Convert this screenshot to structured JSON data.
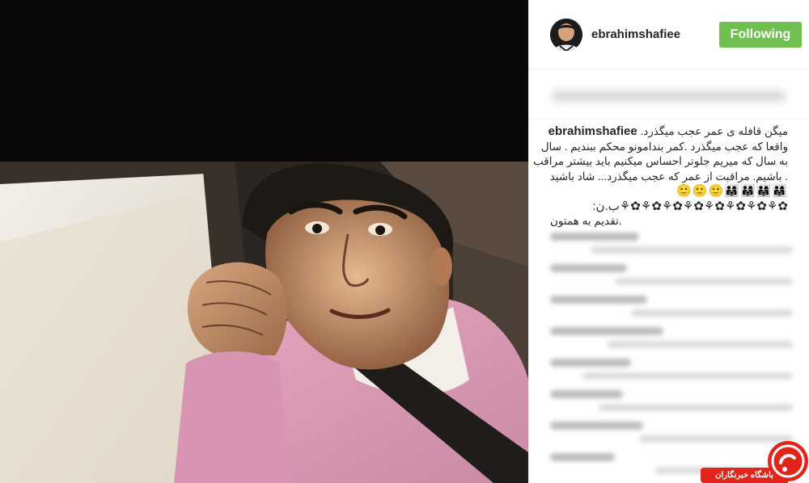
{
  "post": {
    "photo_description_icon": "photo-icon"
  },
  "header": {
    "username": "ebrahimshafiee",
    "follow_button_label": "Following",
    "follow_button_color": "#70c050"
  },
  "caption": {
    "username": "ebrahimshafiee",
    "line1": "میگن قافله ی عمر عجب میگذرد.",
    "line2": "واقعا که عجب میگذرد .کمر بندامونو محکم ببندیم . سال",
    "line3": "به سال که میریم جلوتر احساس میکنیم باید بیشتر مراقب",
    "line4": ". باشیم. مراقبت از عمر که عجب میگذرد... شاد باشید",
    "line5": "👨‍👩‍👧👨‍👩‍👧👨‍👩‍👧👨‍👩‍👧🙂🙂🙂",
    "line6": "✿⚘✿⚘✿⚘✿⚘✿⚘✿⚘✿⚘✿⚘ب.ن:",
    "line7": ".تقدیم به همتون"
  },
  "watermark": {
    "label": "باشگاه خبرنگاران",
    "accent": "#e1251b"
  }
}
